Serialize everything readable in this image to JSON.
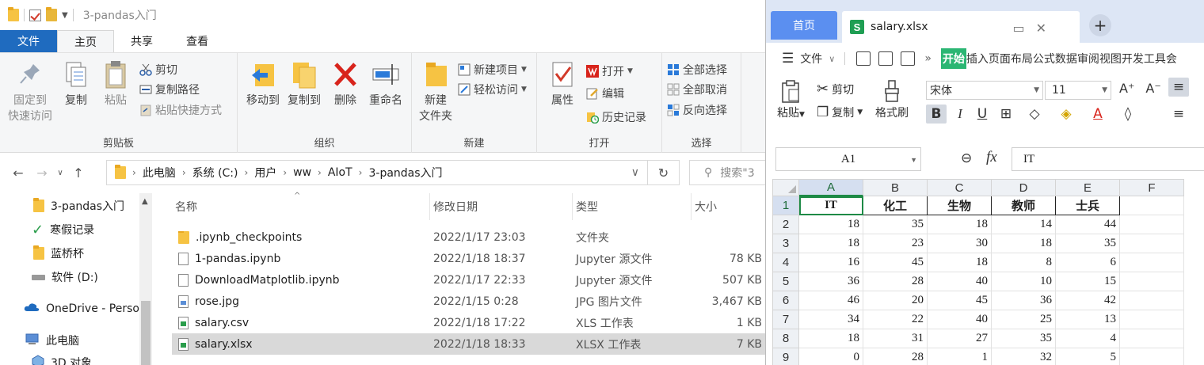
{
  "explorer": {
    "window_title": "3-pandas入门",
    "menu_tabs": [
      "文件",
      "主页",
      "共享",
      "查看"
    ],
    "ribbon": {
      "clipboard": {
        "label": "剪贴板",
        "pin": "固定到\n快速访问",
        "pin_l1": "固定到",
        "pin_l2": "快速访问",
        "copy": "复制",
        "paste": "粘贴",
        "cut": "剪切",
        "copy_path": "复制路径",
        "paste_shortcut": "粘贴快捷方式"
      },
      "organize": {
        "label": "组织",
        "move_to": "移动到",
        "copy_to": "复制到",
        "delete": "删除",
        "rename": "重命名"
      },
      "new": {
        "label": "新建",
        "new_folder_l1": "新建",
        "new_folder_l2": "文件夹",
        "new_item": "新建项目",
        "easy_access": "轻松访问"
      },
      "open": {
        "label": "打开",
        "properties": "属性",
        "open": "打开",
        "edit": "编辑",
        "history": "历史记录"
      },
      "select": {
        "label": "选择",
        "select_all": "全部选择",
        "select_none": "全部取消",
        "invert": "反向选择"
      }
    },
    "address": {
      "crumbs": [
        "此电脑",
        "系统 (C:)",
        "用户",
        "ww",
        "AIoT",
        "3-pandas入门"
      ],
      "search_placeholder": "搜索\"3"
    },
    "nav_pane": [
      {
        "label": "3-pandas入门",
        "icon": "folder-icon"
      },
      {
        "label": "寒假记录",
        "icon": "check-icon"
      },
      {
        "label": "蓝桥杯",
        "icon": "folder-icon"
      },
      {
        "label": "软件 (D:)",
        "icon": "drive-icon"
      },
      {
        "label": "OneDrive - Perso",
        "icon": "cloud-icon"
      },
      {
        "label": "此电脑",
        "icon": "computer-icon"
      },
      {
        "label": "3D 对象",
        "icon": "cube-icon"
      }
    ],
    "columns": [
      "名称",
      "修改日期",
      "类型",
      "大小"
    ],
    "files": [
      {
        "name": ".ipynb_checkpoints",
        "date": "2022/1/17 23:03",
        "type": "文件夹",
        "size": "",
        "icon": "folder"
      },
      {
        "name": "1-pandas.ipynb",
        "date": "2022/1/18 18:37",
        "type": "Jupyter 源文件",
        "size": "78 KB",
        "icon": "file"
      },
      {
        "name": "DownloadMatplotlib.ipynb",
        "date": "2022/1/17 22:33",
        "type": "Jupyter 源文件",
        "size": "507 KB",
        "icon": "file"
      },
      {
        "name": "rose.jpg",
        "date": "2022/1/15 0:28",
        "type": "JPG 图片文件",
        "size": "3,467 KB",
        "icon": "img"
      },
      {
        "name": "salary.csv",
        "date": "2022/1/18 17:22",
        "type": "XLS 工作表",
        "size": "1 KB",
        "icon": "green"
      },
      {
        "name": "salary.xlsx",
        "date": "2022/1/18 18:33",
        "type": "XLSX 工作表",
        "size": "7 KB",
        "icon": "green",
        "selected": true
      }
    ]
  },
  "wps": {
    "home_tab": "首页",
    "doc_tab": "salary.xlsx",
    "doc_icon_letter": "S",
    "menu": {
      "file": "文件",
      "start": "开始",
      "items": "插入页面布局公式数据审阅视图开发工具会"
    },
    "tools": {
      "paste": "粘贴",
      "cut": "剪切",
      "copy": "复制",
      "format_painter": "格式刷",
      "font": "宋体",
      "size": "11"
    },
    "name_box": "A1",
    "formula_value": "IT",
    "columns": [
      "A",
      "B",
      "C",
      "D",
      "E",
      "F"
    ],
    "rows": [
      "1",
      "2",
      "3",
      "4",
      "5",
      "6",
      "7",
      "8",
      "9"
    ],
    "header_row": [
      "IT",
      "化工",
      "生物",
      "教师",
      "士兵"
    ],
    "data": [
      [
        18,
        35,
        18,
        14,
        44
      ],
      [
        18,
        23,
        30,
        18,
        35
      ],
      [
        16,
        45,
        18,
        8,
        6
      ],
      [
        36,
        28,
        40,
        10,
        15
      ],
      [
        46,
        20,
        45,
        36,
        42
      ],
      [
        34,
        22,
        40,
        25,
        13
      ],
      [
        18,
        31,
        27,
        35,
        4
      ],
      [
        0,
        28,
        1,
        32,
        5
      ]
    ],
    "accent_green": "#1e8a46"
  }
}
